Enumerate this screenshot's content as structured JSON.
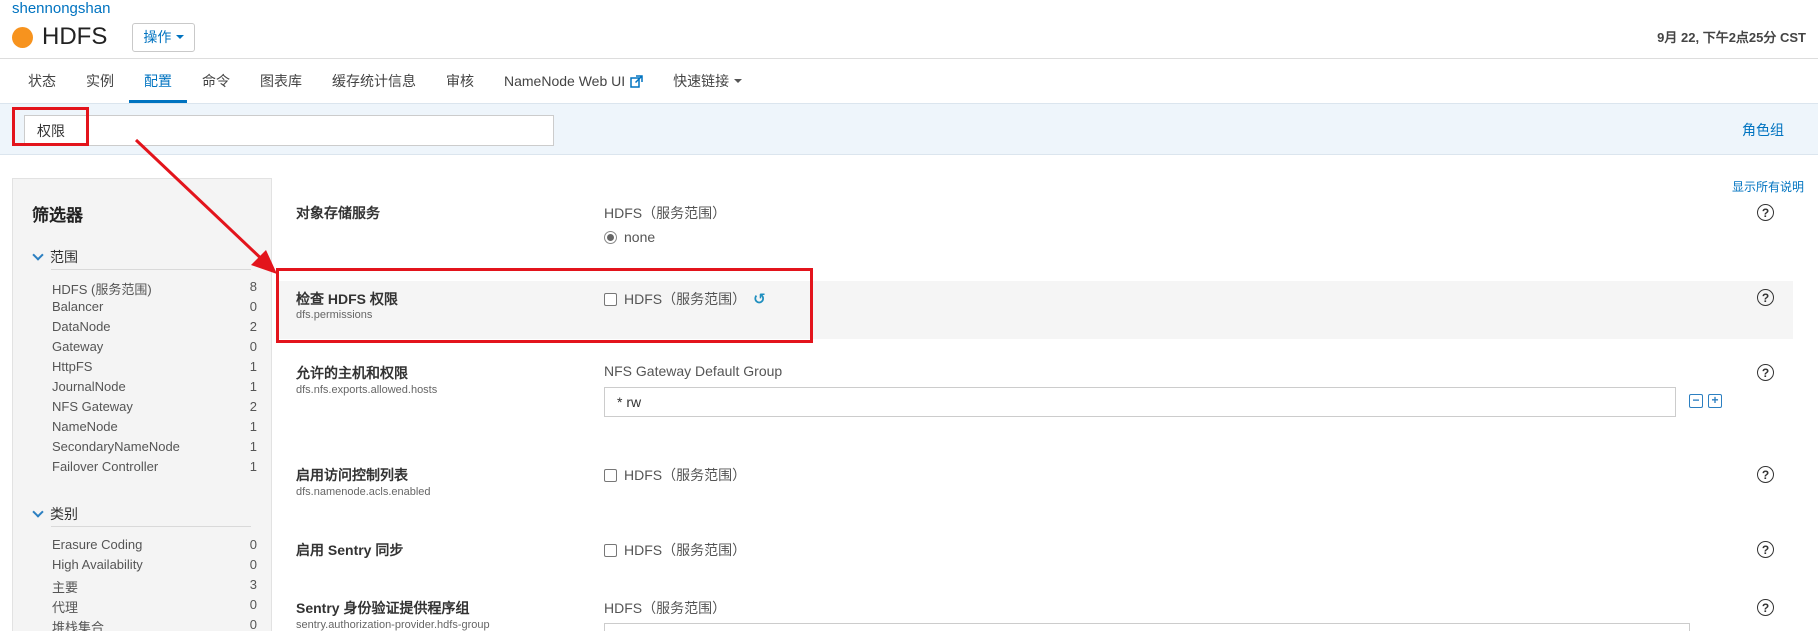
{
  "header": {
    "cluster_link": "shennongshan",
    "service_name": "HDFS",
    "actions_label": "操作",
    "timestamp": "9月 22, 下午2点25分 CST",
    "status_color": "#f7931e"
  },
  "tabs": [
    {
      "label": "状态"
    },
    {
      "label": "实例"
    },
    {
      "label": "配置"
    },
    {
      "label": "命令"
    },
    {
      "label": "图表库"
    },
    {
      "label": "缓存统计信息"
    },
    {
      "label": "审核"
    },
    {
      "label": "NameNode Web UI"
    },
    {
      "label": "快速链接"
    }
  ],
  "active_tab": "配置",
  "search": {
    "value": "权限"
  },
  "role_groups_link": "角色组",
  "show_all_descriptions": "显示所有说明",
  "filters": {
    "title": "筛选器",
    "scope": {
      "heading": "范围",
      "items": [
        {
          "label": "HDFS (服务范围)",
          "count": "8"
        },
        {
          "label": "Balancer",
          "count": "0"
        },
        {
          "label": "DataNode",
          "count": "2"
        },
        {
          "label": "Gateway",
          "count": "0"
        },
        {
          "label": "HttpFS",
          "count": "1"
        },
        {
          "label": "JournalNode",
          "count": "1"
        },
        {
          "label": "NFS Gateway",
          "count": "2"
        },
        {
          "label": "NameNode",
          "count": "1"
        },
        {
          "label": "SecondaryNameNode",
          "count": "1"
        },
        {
          "label": "Failover Controller",
          "count": "1"
        }
      ]
    },
    "category": {
      "heading": "类别",
      "items": [
        {
          "label": "Erasure Coding",
          "count": "0"
        },
        {
          "label": "High Availability",
          "count": "0"
        },
        {
          "label": "主要",
          "count": "3"
        },
        {
          "label": "代理",
          "count": "0"
        },
        {
          "label": "堆栈集合",
          "count": "0"
        }
      ]
    }
  },
  "configs": [
    {
      "name": "对象存储服务",
      "key": "",
      "scope": "HDFS（服务范围）",
      "value": "none"
    },
    {
      "name": "检查 HDFS 权限",
      "key": "dfs.permissions",
      "scope": "HDFS（服务范围）"
    },
    {
      "name": "允许的主机和权限",
      "key": "dfs.nfs.exports.allowed.hosts",
      "scope": "NFS Gateway Default Group",
      "value": "* rw"
    },
    {
      "name": "启用访问控制列表",
      "key": "dfs.namenode.acls.enabled",
      "scope": "HDFS（服务范围）"
    },
    {
      "name": "启用 Sentry 同步",
      "key": "",
      "scope": "HDFS（服务范围）"
    },
    {
      "name": "Sentry 身份验证提供程序组",
      "key": "sentry.authorization-provider.hdfs-group",
      "scope": "HDFS（服务范围）"
    }
  ],
  "annotation_color": "#e3141c"
}
